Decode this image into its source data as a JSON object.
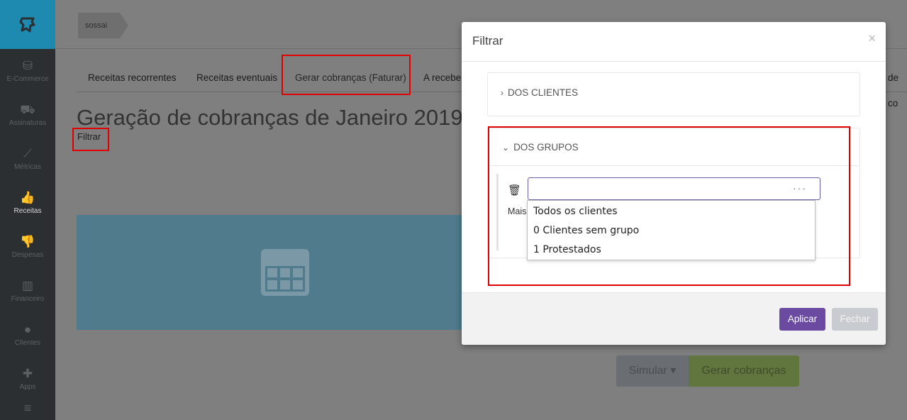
{
  "sidebar": {
    "items": [
      {
        "label": "E-Commerce",
        "icon": "shop-icon"
      },
      {
        "label": "Assinaturas",
        "icon": "cart-icon"
      },
      {
        "label": "Métricas",
        "icon": "chart-line-icon"
      },
      {
        "label": "Receitas",
        "icon": "thumbs-up-icon",
        "active": true
      },
      {
        "label": "Despesas",
        "icon": "thumbs-down-icon"
      },
      {
        "label": "Financeiro",
        "icon": "bar-chart-icon"
      },
      {
        "label": "Clientes",
        "icon": "users-icon"
      },
      {
        "label": "Apps",
        "icon": "puzzle-icon"
      }
    ]
  },
  "breadcrumb": {
    "label": "sossai"
  },
  "tabs": [
    "Receitas recorrentes",
    "Receitas eventuais",
    "Gerar cobranças (Faturar)",
    "A receber",
    "de co"
  ],
  "page": {
    "title": "Geração de cobranças de Janeiro 2019",
    "filter_link": "Filtrar"
  },
  "actions": {
    "simular_label": "Simular ▾",
    "gerar_label": "Gerar cobranças"
  },
  "modal": {
    "title": "Filtrar",
    "close_glyph": "×",
    "panel_clientes": "DOS CLIENTES",
    "panel_grupos": "DOS GRUPOS",
    "select_value": "",
    "select_dots": "···",
    "mais_label": "Mais",
    "dropdown_options": [
      "Todos os clientes",
      "0 Clientes sem grupo",
      "1 Protestados"
    ],
    "apply_label": "Aplicar",
    "close_label": "Fechar"
  },
  "colors": {
    "brand_blue": "#1f8ab0",
    "apply_purple": "#6a4ba1",
    "annotation_red": "#e00000",
    "gerar_green": "#61753f"
  }
}
